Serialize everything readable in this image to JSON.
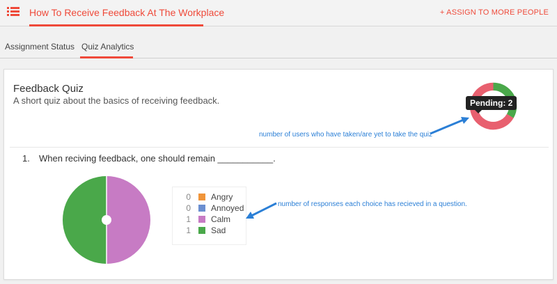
{
  "header": {
    "title": "How To Receive Feedback At The Workplace",
    "assign_label": "+ ASSIGN TO MORE PEOPLE",
    "accent": "#ef4a3a"
  },
  "tabs": [
    {
      "label": "Assignment Status",
      "active": false
    },
    {
      "label": "Quiz Analytics",
      "active": true
    }
  ],
  "quiz": {
    "title": "Feedback Quiz",
    "description": "A short quiz about the basics of receiving feedback.",
    "status_tooltip": "Pending: 2",
    "status_note": "number of users who have taken/are yet to take the quiz",
    "status_donut": {
      "pending": 2,
      "completed": 1,
      "colors": {
        "pending": "#e8606f",
        "completed": "#4aa84a"
      }
    }
  },
  "question": {
    "number": "1.",
    "text": "When reciving feedback, one should remain ___________.",
    "note": "number of responses each choice has recieved in a question.",
    "choices": [
      {
        "count": "0",
        "label": "Angry",
        "color": "#f0953a"
      },
      {
        "count": "0",
        "label": "Annoyed",
        "color": "#6b8fd0"
      },
      {
        "count": "1",
        "label": "Calm",
        "color": "#c77bc4"
      },
      {
        "count": "1",
        "label": "Sad",
        "color": "#4aa84a"
      }
    ]
  }
}
